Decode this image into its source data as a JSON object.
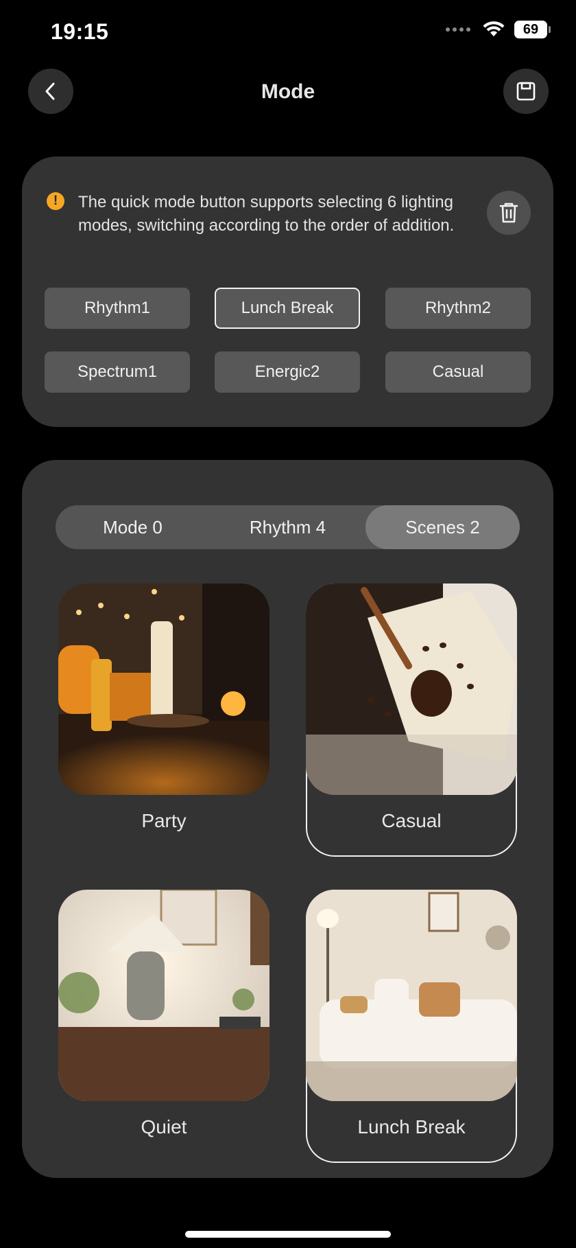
{
  "status": {
    "time": "19:15",
    "battery": "69"
  },
  "header": {
    "title": "Mode"
  },
  "quick": {
    "notice": "The quick mode button supports selecting 6 lighting modes, switching according to the order of addition.",
    "chips": [
      "Rhythm1",
      "Lunch Break",
      "Rhythm2",
      "Spectrum1",
      "Energic2",
      "Casual"
    ],
    "selected": "Lunch Break"
  },
  "tabs": [
    "Mode 0",
    "Rhythm 4",
    "Scenes 2"
  ],
  "active_tab": "Scenes 2",
  "scenes": [
    "Party",
    "Casual",
    "Quiet",
    "Lunch Break"
  ],
  "selected_scenes": [
    "Casual",
    "Lunch Break"
  ],
  "colors": {
    "accent_info": "#f5a623",
    "card": "#333333",
    "chip": "#585858"
  }
}
